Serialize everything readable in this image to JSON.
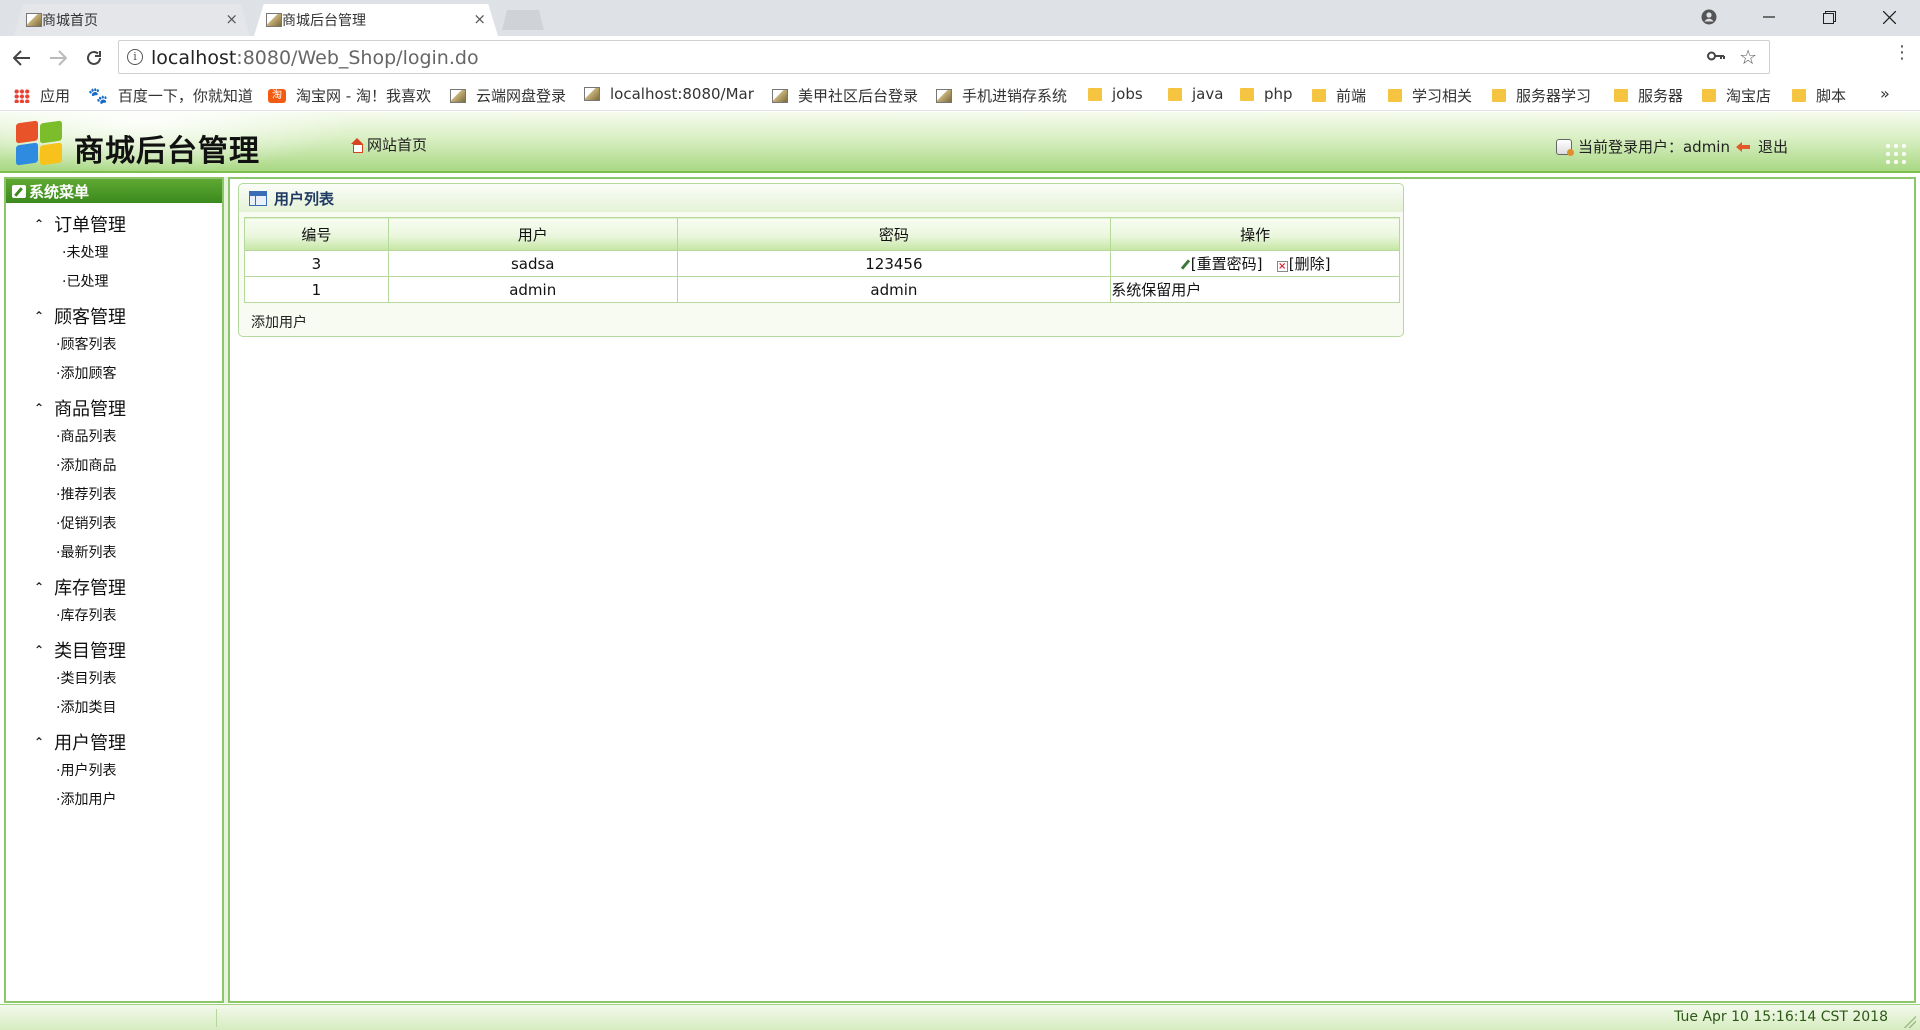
{
  "browser": {
    "tabs": [
      {
        "title": "商城首页"
      },
      {
        "title": "商城后台管理"
      }
    ],
    "url_host": "localhost",
    "url_path": ":8080/Web_Shop/login.do",
    "bookmarks": [
      {
        "label": "应用",
        "icon": "apps-icon"
      },
      {
        "label": "百度一下，你就知道",
        "icon": "baidu-icon"
      },
      {
        "label": "淘宝网 - 淘！我喜欢",
        "icon": "taobao-icon"
      },
      {
        "label": "云端网盘登录",
        "icon": "page-icon"
      },
      {
        "label": "localhost:8080/Mar",
        "icon": "page-icon"
      },
      {
        "label": "美甲社区后台登录",
        "icon": "page-icon"
      },
      {
        "label": "手机进销存系统",
        "icon": "page-icon"
      },
      {
        "label": "jobs",
        "icon": "folder-icon"
      },
      {
        "label": "java",
        "icon": "folder-icon"
      },
      {
        "label": "php",
        "icon": "folder-icon"
      },
      {
        "label": "前端",
        "icon": "folder-icon"
      },
      {
        "label": "学习相关",
        "icon": "folder-icon"
      },
      {
        "label": "服务器学习",
        "icon": "folder-icon"
      },
      {
        "label": "服务器",
        "icon": "folder-icon"
      },
      {
        "label": "淘宝店",
        "icon": "folder-icon"
      },
      {
        "label": "脚本",
        "icon": "folder-icon"
      }
    ],
    "more": "»",
    "taobao_icon_text": "淘"
  },
  "header": {
    "title": "商城后台管理",
    "home_link": "网站首页",
    "user_prefix": "当前登录用户：",
    "username": "admin",
    "logout": "退出"
  },
  "sidebar": {
    "title": "系统菜单",
    "groups": [
      {
        "title": "订单管理",
        "items": [
          "·未处理",
          "·已处理"
        ]
      },
      {
        "title": "顾客管理",
        "items": [
          "·顾客列表",
          "·添加顾客"
        ]
      },
      {
        "title": "商品管理",
        "items": [
          "·商品列表",
          "·添加商品",
          "·推荐列表",
          "·促销列表",
          "·最新列表"
        ]
      },
      {
        "title": "库存管理",
        "items": [
          "·库存列表"
        ]
      },
      {
        "title": "类目管理",
        "items": [
          "·类目列表",
          "·添加类目"
        ]
      },
      {
        "title": "用户管理",
        "items": [
          "·用户列表",
          "·添加用户"
        ]
      }
    ]
  },
  "main": {
    "panel_title": "用户列表",
    "columns": [
      "编号",
      "用户",
      "密码",
      "操作"
    ],
    "rows": [
      {
        "id": "3",
        "user": "sadsa",
        "password": "123456",
        "reset": "[重置密码]",
        "delete": "[删除]"
      },
      {
        "id": "1",
        "user": "admin",
        "password": "admin",
        "note": "系统保留用户"
      }
    ],
    "add_user": "添加用户"
  },
  "status": {
    "clock": "Tue Apr 10 15:16:14 CST 2018"
  },
  "colors": {
    "accent_green": "#8cc66a",
    "menu_header_green": "#3b8a1e",
    "panel_title_blue": "#1f3a63"
  }
}
